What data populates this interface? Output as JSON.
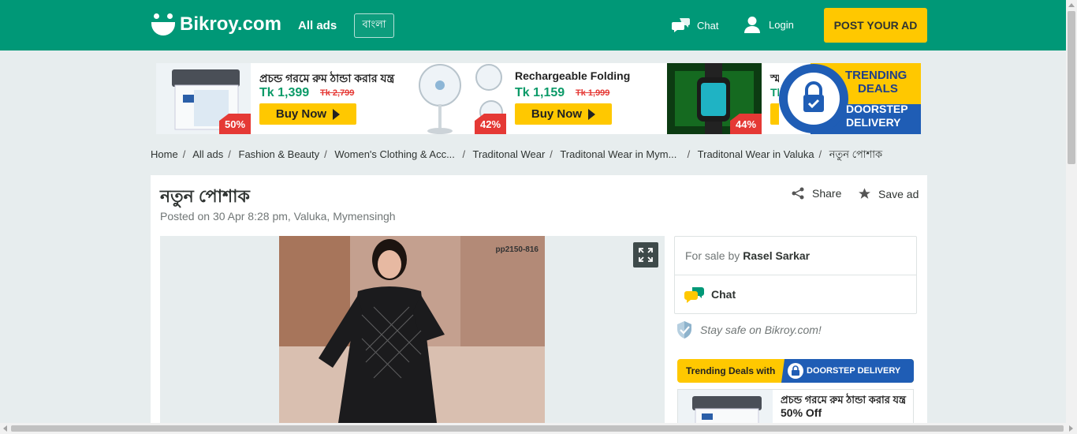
{
  "header": {
    "logo_text": "Bikroy.com",
    "all_ads": "All ads",
    "language": "বাংলা",
    "chat": "Chat",
    "login": "Login",
    "post_ad": "POST YOUR AD",
    "brand_color": "#009877",
    "accent_color": "#ffc800"
  },
  "banner": {
    "items": [
      {
        "title": "প্রচন্ড গরমে রুম ঠান্ডা করার যন্ত্র",
        "price": "Tk 1,399",
        "old_price": "Tk 2,799",
        "discount": "50%",
        "buy": "Buy Now"
      },
      {
        "title": "Rechargeable Folding",
        "price": "Tk 1,159",
        "old_price": "Tk 1,999",
        "discount": "42%",
        "buy": "Buy Now"
      },
      {
        "title": "স্মার্ট",
        "price": "Tk",
        "discount": "44%"
      }
    ],
    "badge_line1": "TRENDING",
    "badge_line2": "DEALS",
    "badge_line3": "DOORSTEP",
    "badge_line4": "DELIVERY"
  },
  "breadcrumb": [
    "Home",
    "All ads",
    "Fashion & Beauty",
    "Women's Clothing & Acc...",
    "Traditonal Wear",
    "Traditonal Wear in Mym...",
    "Traditonal Wear in Valuka",
    "নতুন পোশাক"
  ],
  "ad": {
    "title": "নতুন পোশাক",
    "posted": "Posted on 30 Apr 8:28 pm, Valuka, Mymensingh",
    "share": "Share",
    "save": "Save ad",
    "photo_id": "pp2150-816"
  },
  "seller": {
    "for_sale_by": "For sale by",
    "name": "Rasel Sarkar",
    "chat": "Chat",
    "safe": "Stay safe on Bikroy.com!"
  },
  "trending": {
    "label": "Trending Deals with",
    "delivery": "DOORSTEP DELIVERY",
    "ad_title": "প্রচন্ড গরমে রুম ঠান্ডা করার যন্ত্র",
    "ad_off": "50% Off"
  }
}
